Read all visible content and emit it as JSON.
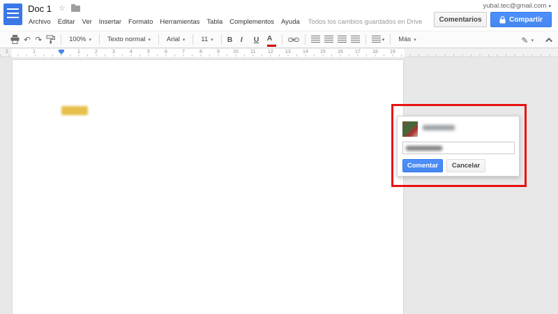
{
  "header": {
    "title": "Doc 1",
    "menus": [
      "Archivo",
      "Editar",
      "Ver",
      "Insertar",
      "Formato",
      "Herramientas",
      "Tabla",
      "Complementos",
      "Ayuda"
    ],
    "saved_status": "Todos los cambios guardados en Drive",
    "account_email": "yubal.tec@gmail.com",
    "comments_label": "Comentarios",
    "share_label": "Compartir"
  },
  "toolbar": {
    "zoom": "100%",
    "paragraph_style": "Texto normal",
    "font": "Arial",
    "font_size": "11",
    "bold_label": "B",
    "italic_label": "I",
    "underline_label": "U",
    "text_color_label": "A",
    "more_label": "Más"
  },
  "ruler": {
    "left_numbers": [
      "2",
      "1"
    ],
    "numbers": [
      "1",
      "2",
      "3",
      "4",
      "5",
      "6",
      "7",
      "8",
      "9",
      "10",
      "11",
      "12",
      "13",
      "14",
      "15",
      "16",
      "17",
      "18",
      "19"
    ]
  },
  "comment_popup": {
    "submit_label": "Comentar",
    "cancel_label": "Cancelar"
  },
  "icons": {
    "star": "☆",
    "undo": "↶",
    "redo": "↷",
    "pencil": "✎",
    "caret": "▾"
  },
  "colors": {
    "accent_blue": "#4285f4",
    "button_blue": "#4d90fe",
    "annotation_red": "#ea1010",
    "highlight_yellow": "#e6c04a"
  }
}
